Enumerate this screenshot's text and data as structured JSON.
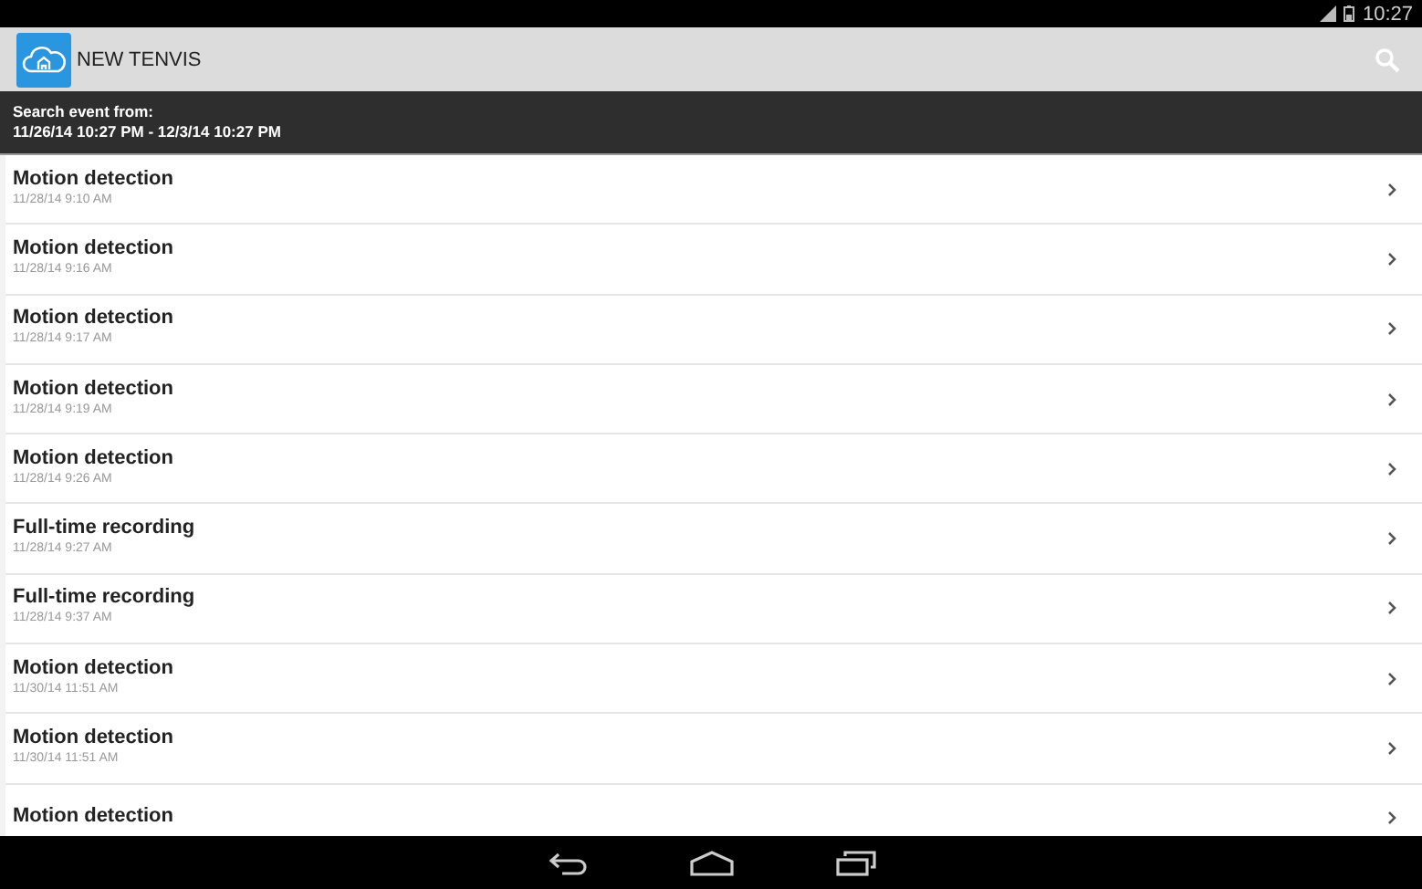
{
  "status_bar": {
    "time": "10:27"
  },
  "app_bar": {
    "title": "NEW TENVIS"
  },
  "search_header": {
    "label": "Search event from:",
    "range": "11/26/14 10:27 PM - 12/3/14 10:27 PM"
  },
  "events": [
    {
      "title": "Motion detection",
      "time": "11/28/14 9:10 AM"
    },
    {
      "title": "Motion detection",
      "time": "11/28/14 9:16 AM"
    },
    {
      "title": "Motion detection",
      "time": "11/28/14 9:17 AM"
    },
    {
      "title": "Motion detection",
      "time": "11/28/14 9:19 AM"
    },
    {
      "title": "Motion detection",
      "time": "11/28/14 9:26 AM"
    },
    {
      "title": "Full-time recording",
      "time": "11/28/14 9:27 AM"
    },
    {
      "title": "Full-time recording",
      "time": "11/28/14 9:37 AM"
    },
    {
      "title": "Motion detection",
      "time": "11/30/14 11:51 AM"
    },
    {
      "title": "Motion detection",
      "time": "11/30/14 11:51 AM"
    },
    {
      "title": "Motion detection"
    }
  ]
}
